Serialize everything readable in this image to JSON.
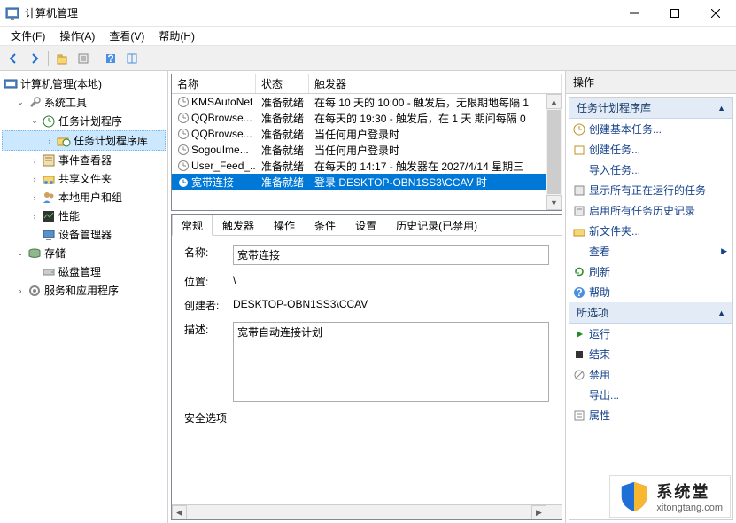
{
  "window": {
    "title": "计算机管理",
    "min": "—",
    "max": "□",
    "close": "✕"
  },
  "menu": {
    "file": "文件(F)",
    "action": "操作(A)",
    "view": "查看(V)",
    "help": "帮助(H)"
  },
  "tree": {
    "root": "计算机管理(本地)",
    "systools": "系统工具",
    "scheduler": "任务计划程序",
    "schedlib": "任务计划程序库",
    "eventviewer": "事件查看器",
    "sharedfolders": "共享文件夹",
    "localusers": "本地用户和组",
    "perf": "性能",
    "devmgr": "设备管理器",
    "storage": "存储",
    "diskmgmt": "磁盘管理",
    "services": "服务和应用程序"
  },
  "tasklist": {
    "cols": {
      "name": "名称",
      "status": "状态",
      "trigger": "触发器"
    },
    "rows": [
      {
        "name": "KMSAutoNet",
        "status": "准备就绪",
        "trigger": "在每 10 天的 10:00 - 触发后，无限期地每隔 1"
      },
      {
        "name": "QQBrowse...",
        "status": "准备就绪",
        "trigger": "在每天的 19:30 - 触发后，在 1 天 期间每隔 0"
      },
      {
        "name": "QQBrowse...",
        "status": "准备就绪",
        "trigger": "当任何用户登录时"
      },
      {
        "name": "SogouIme...",
        "status": "准备就绪",
        "trigger": "当任何用户登录时"
      },
      {
        "name": "User_Feed_...",
        "status": "准备就绪",
        "trigger": "在每天的 14:17 - 触发器在 2027/4/14 星期三"
      },
      {
        "name": "宽带连接",
        "status": "准备就绪",
        "trigger": "登录 DESKTOP-OBN1SS3\\CCAV 时"
      }
    ]
  },
  "tabs": {
    "general": "常规",
    "triggers": "触发器",
    "actions": "操作",
    "conditions": "条件",
    "settings": "设置",
    "history": "历史记录(已禁用)"
  },
  "details": {
    "name_label": "名称:",
    "name_value": "宽带连接",
    "location_label": "位置:",
    "location_value": "\\",
    "creator_label": "创建者:",
    "creator_value": "DESKTOP-OBN1SS3\\CCAV",
    "desc_label": "描述:",
    "desc_value": "宽带自动连接计划",
    "security_label": "安全选项"
  },
  "actions": {
    "header": "操作",
    "section1": "任务计划程序库",
    "createbasic": "创建基本任务...",
    "createtask": "创建任务...",
    "importtask": "导入任务...",
    "showrunning": "显示所有正在运行的任务",
    "enablehistory": "启用所有任务历史记录",
    "newfolder": "新文件夹...",
    "view": "查看",
    "refresh": "刷新",
    "help": "帮助",
    "section2": "所选项",
    "run": "运行",
    "end": "结束",
    "disable": "禁用",
    "export": "导出...",
    "properties": "属性"
  },
  "watermark": {
    "main": "系统堂",
    "sub": "xitongtang.com"
  }
}
